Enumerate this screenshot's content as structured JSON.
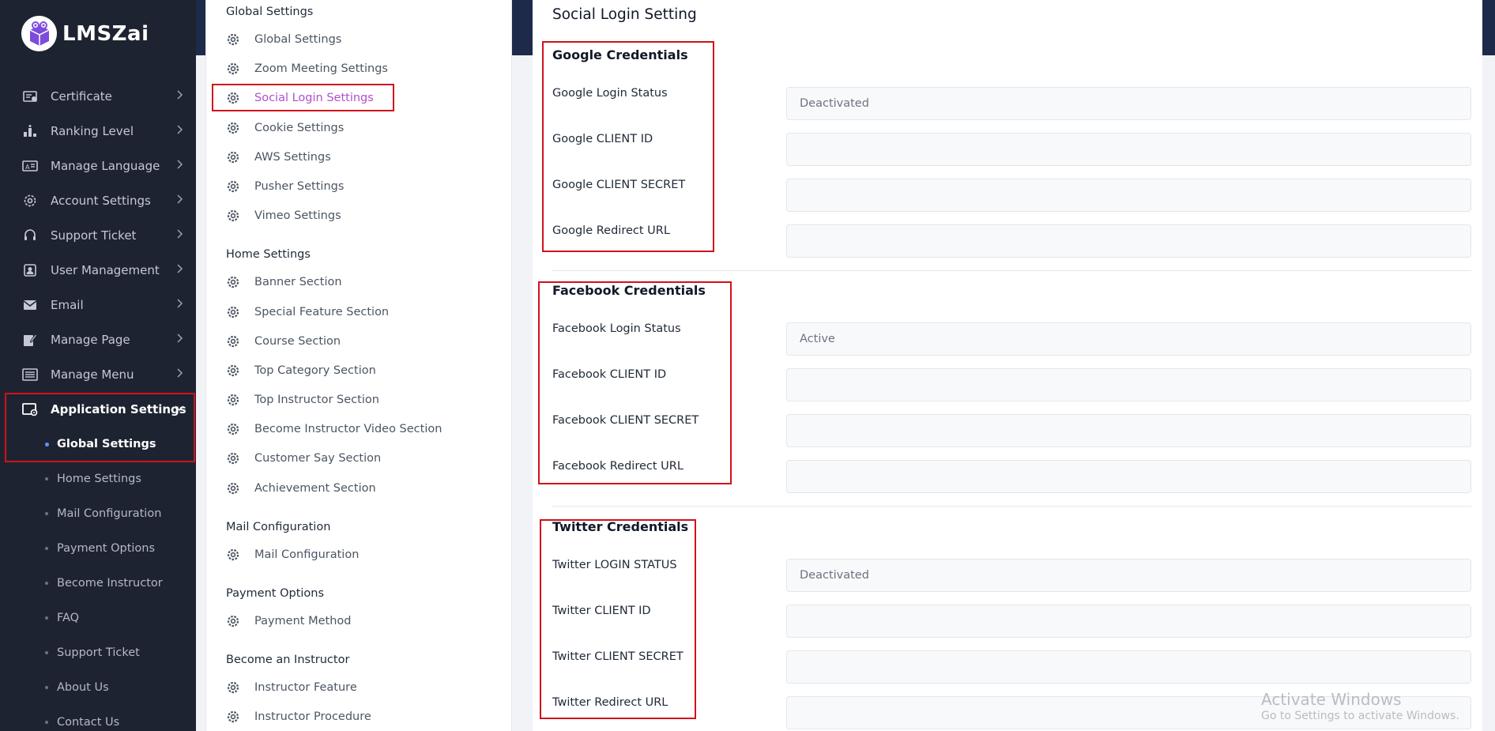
{
  "app": {
    "name": "LMSZai"
  },
  "sidebar": {
    "items": [
      {
        "label": "Certificate",
        "icon": "certificate-icon"
      },
      {
        "label": "Ranking Level",
        "icon": "ranking-icon"
      },
      {
        "label": "Manage Language",
        "icon": "language-icon"
      },
      {
        "label": "Account Settings",
        "icon": "gear-icon"
      },
      {
        "label": "Support Ticket",
        "icon": "headset-icon"
      },
      {
        "label": "User Management",
        "icon": "user-icon"
      },
      {
        "label": "Email",
        "icon": "envelope-icon"
      },
      {
        "label": "Manage Page",
        "icon": "page-edit-icon"
      },
      {
        "label": "Manage Menu",
        "icon": "menu-icon"
      },
      {
        "label": "Application Settings",
        "icon": "app-settings-icon"
      }
    ],
    "sub_items": [
      {
        "label": "Global Settings"
      },
      {
        "label": "Home Settings"
      },
      {
        "label": "Mail Configuration"
      },
      {
        "label": "Payment Options"
      },
      {
        "label": "Become Instructor"
      },
      {
        "label": "FAQ"
      },
      {
        "label": "Support Ticket"
      },
      {
        "label": "About Us"
      },
      {
        "label": "Contact Us"
      }
    ]
  },
  "settings_menu": {
    "global": {
      "title": "Global Settings",
      "items": [
        "Global Settings",
        "Zoom Meeting Settings",
        "Social Login Settings",
        "Cookie Settings",
        "AWS Settings",
        "Pusher Settings",
        "Vimeo Settings"
      ]
    },
    "home": {
      "title": "Home Settings",
      "items": [
        "Banner Section",
        "Special Feature Section",
        "Course Section",
        "Top Category Section",
        "Top Instructor Section",
        "Become Instructor Video Section",
        "Customer Say Section",
        "Achievement Section"
      ]
    },
    "mail": {
      "title": "Mail Configuration",
      "items": [
        "Mail Configuration"
      ]
    },
    "payment": {
      "title": "Payment Options",
      "items": [
        "Payment Method"
      ]
    },
    "instructor": {
      "title": "Become an Instructor",
      "items": [
        "Instructor Feature",
        "Instructor Procedure"
      ]
    }
  },
  "main": {
    "title": "Social Login Setting",
    "google": {
      "title": "Google Credentials",
      "fields": [
        {
          "label": "Google Login Status",
          "value": "Deactivated"
        },
        {
          "label": "Google CLIENT ID",
          "value": ""
        },
        {
          "label": "Google CLIENT SECRET",
          "value": ""
        },
        {
          "label": "Google Redirect URL",
          "value": ""
        }
      ]
    },
    "facebook": {
      "title": "Facebook Credentials",
      "fields": [
        {
          "label": "Facebook Login Status",
          "value": "Active"
        },
        {
          "label": "Facebook CLIENT ID",
          "value": ""
        },
        {
          "label": "Facebook CLIENT SECRET",
          "value": ""
        },
        {
          "label": "Facebook Redirect URL",
          "value": ""
        }
      ]
    },
    "twitter": {
      "title": "Twitter Credentials",
      "fields": [
        {
          "label": "Twitter LOGIN STATUS",
          "value": "Deactivated"
        },
        {
          "label": "Twitter CLIENT ID",
          "value": ""
        },
        {
          "label": "Twitter CLIENT SECRET",
          "value": ""
        },
        {
          "label": "Twitter Redirect URL",
          "value": ""
        }
      ]
    }
  },
  "watermark": {
    "line1": "Activate Windows",
    "line2": "Go to Settings to activate Windows."
  },
  "colors": {
    "sidebar_bg": "#1e2331",
    "highlight_red": "#d0121b",
    "selected_link": "#b04fcf",
    "active_dot": "#6b8cff"
  }
}
